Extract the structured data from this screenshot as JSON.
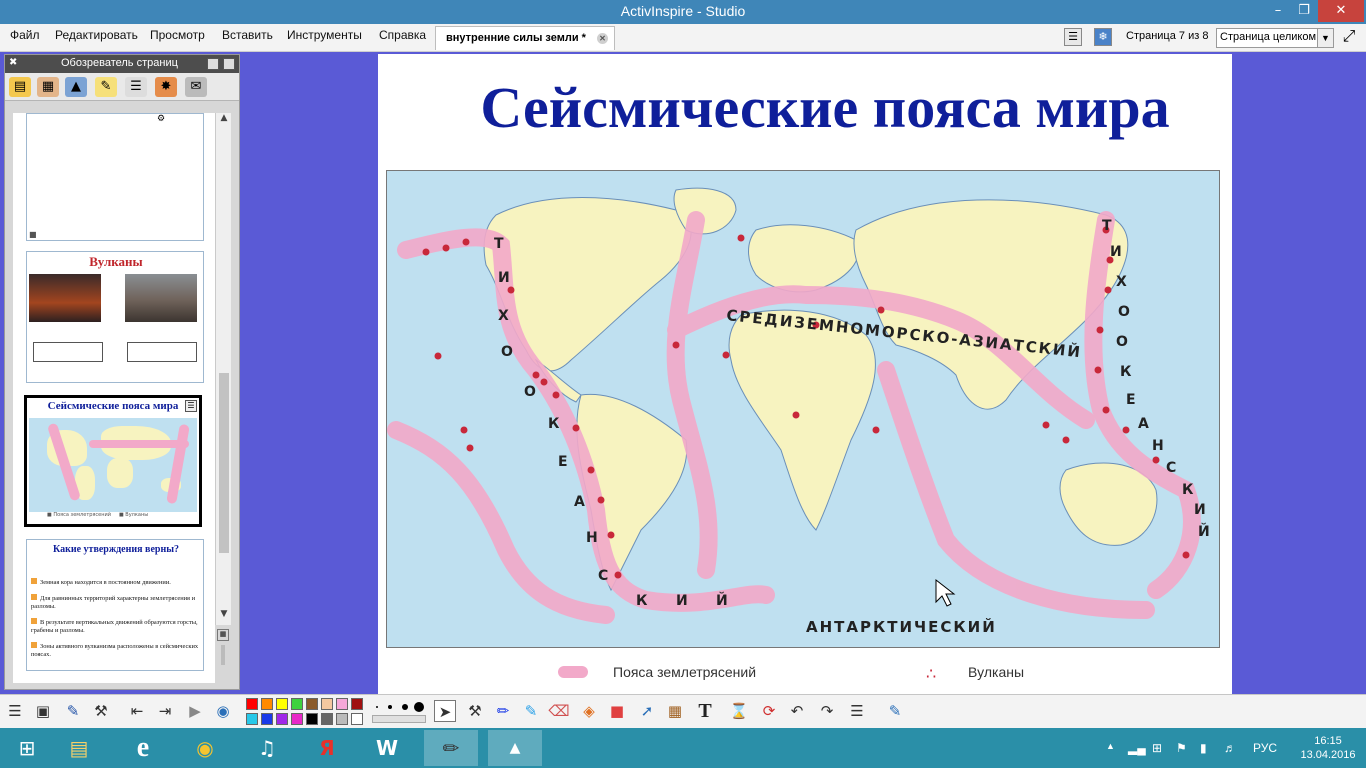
{
  "window": {
    "title": "ActivInspire - Studio"
  },
  "menu": [
    "Файл",
    "Редактировать",
    "Просмотр",
    "Вставить",
    "Инструменты",
    "Справка"
  ],
  "document_tab": {
    "label": "внутренние силы земли *"
  },
  "page_indicator": "Страница 7 из 8",
  "zoom": {
    "value": "Страница целиком"
  },
  "page_browser": {
    "title": "Обозреватель страниц",
    "thumbnails": [
      {
        "title": ""
      },
      {
        "title": "Вулканы"
      },
      {
        "title": "Сейсмические пояса мира"
      },
      {
        "title": "Какие утверждения верны?",
        "items": [
          "Земная кора находится в постоянном движении.",
          "Для равнинных территорий характерны землетрясения и разломы.",
          "В результате вертикальных движений образуются горсты, грабены и разломы.",
          "Зоны активного вулканизма расположены в сейсмических поясах."
        ]
      }
    ]
  },
  "slide": {
    "title": "Сейсмические пояса мира",
    "map_labels": {
      "pacific_left": [
        "Т",
        "И",
        "Х",
        "О",
        "О",
        "К",
        "Е",
        "А",
        "Н",
        "С",
        "К",
        "И",
        "Й"
      ],
      "pacific_right": [
        "Т",
        "И",
        "Х",
        "О",
        "О",
        "К",
        "Е",
        "А",
        "Н",
        "С",
        "К",
        "И",
        "Й"
      ],
      "mediterranean": "СРЕДИЗЕМНОМОРСКО-АЗИАТСКИЙ",
      "antarctic": "АНТАРКТИЧЕСКИЙ"
    },
    "legend": {
      "belts": "Пояса землетрясений",
      "volcanoes": "Вулканы"
    },
    "colors": {
      "ocean": "#bfe0f0",
      "land": "#f7f3c0",
      "belt": "#f2a9c9",
      "volcano": "#c8283a"
    }
  },
  "taskbar": {
    "language": "РУС",
    "time": "16:15",
    "date": "13.04.2016"
  }
}
